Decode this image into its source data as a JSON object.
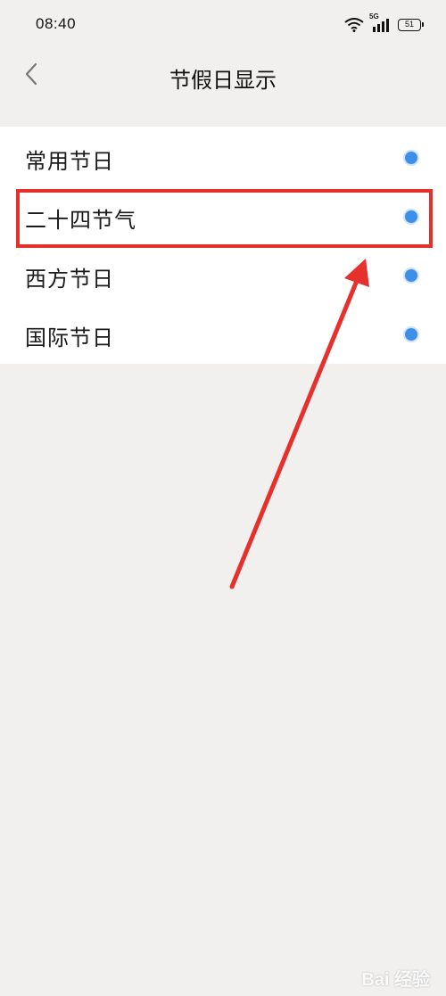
{
  "status_bar": {
    "time": "08:40",
    "network": "5G",
    "battery": "51"
  },
  "header": {
    "title": "节假日显示"
  },
  "holiday_options": [
    {
      "label": "常用节日",
      "selected": true
    },
    {
      "label": "二十四节气",
      "selected": true
    },
    {
      "label": "西方节日",
      "selected": true
    },
    {
      "label": "国际节日",
      "selected": true
    }
  ],
  "annotation": {
    "highlight_color": "#e5302c"
  },
  "accent_color": "#3d8fe8",
  "watermark": "Bai 经验"
}
